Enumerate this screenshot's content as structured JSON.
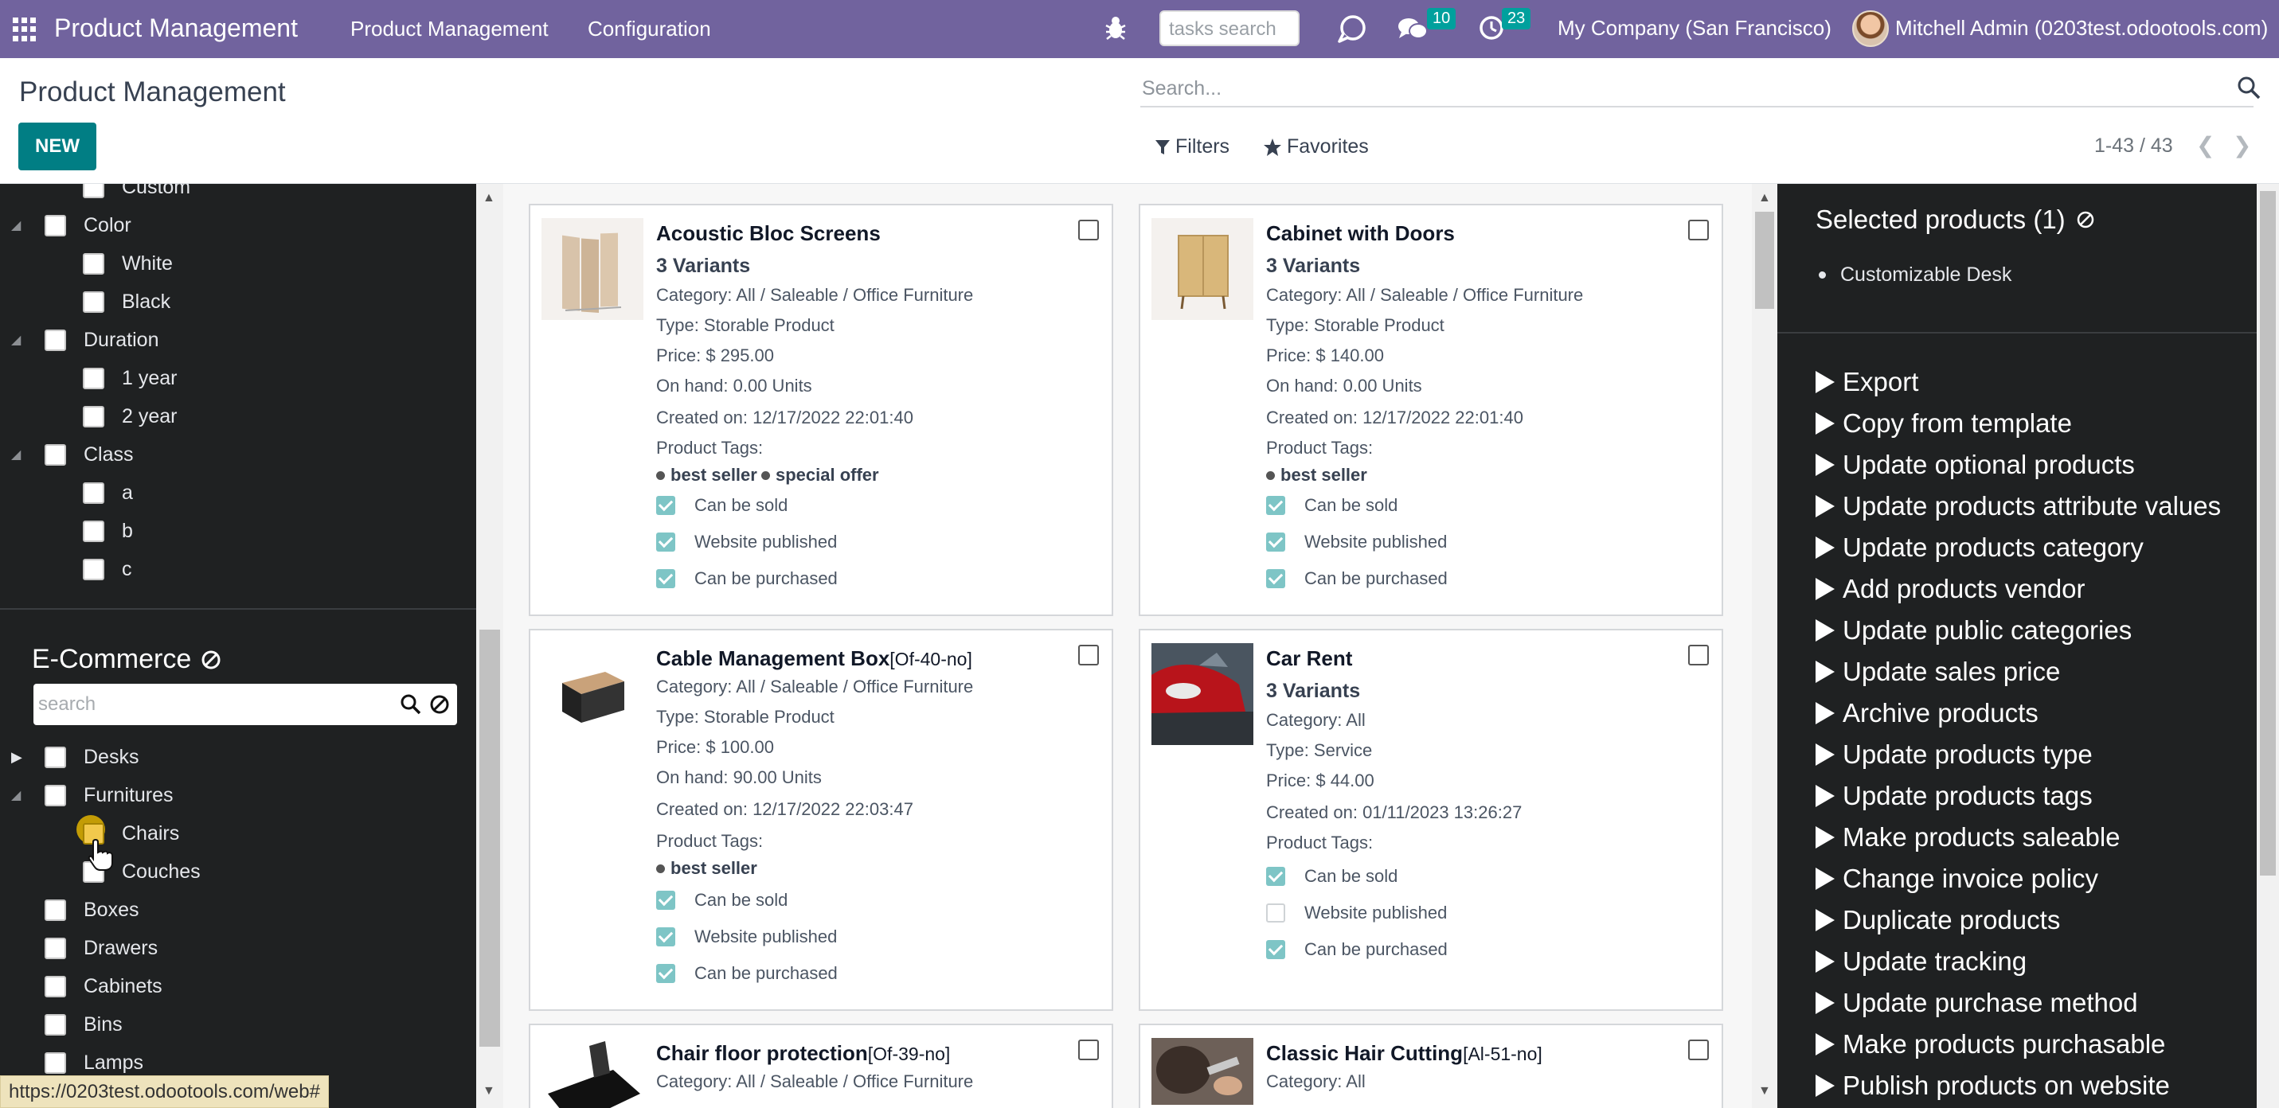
{
  "navbar": {
    "brand": "Product Management",
    "menus": [
      "Product Management",
      "Configuration"
    ],
    "tasks_search_placeholder": "tasks search",
    "messages_count": "10",
    "activities_count": "23",
    "company": "My Company (San Francisco)",
    "user": "Mitchell Admin (0203test.odootools.com)",
    "bg_color": "#71639e"
  },
  "control": {
    "title": "Product Management",
    "new_label": "NEW",
    "search_placeholder": "Search...",
    "filters_label": "Filters",
    "favorites_label": "Favorites",
    "pager": "1-43 / 43"
  },
  "attributes": {
    "items": [
      {
        "label": "Custom",
        "level": 1
      },
      {
        "label": "Color",
        "level": 0
      },
      {
        "label": "White",
        "level": 1
      },
      {
        "label": "Black",
        "level": 1
      },
      {
        "label": "Duration",
        "level": 0
      },
      {
        "label": "1 year",
        "level": 1
      },
      {
        "label": "2 year",
        "level": 1
      },
      {
        "label": "Class",
        "level": 0
      },
      {
        "label": "a",
        "level": 1
      },
      {
        "label": "b",
        "level": 1
      },
      {
        "label": "c",
        "level": 1
      }
    ]
  },
  "ecommerce": {
    "title": "E-Commerce",
    "search_placeholder": "search",
    "items": [
      {
        "label": "Desks",
        "level": 0
      },
      {
        "label": "Furnitures",
        "level": 0
      },
      {
        "label": "Chairs",
        "level": 1
      },
      {
        "label": "Couches",
        "level": 1
      },
      {
        "label": "Boxes",
        "level": 0
      },
      {
        "label": "Drawers",
        "level": 0
      },
      {
        "label": "Cabinets",
        "level": 0
      },
      {
        "label": "Bins",
        "level": 0
      },
      {
        "label": "Lamps",
        "level": 0
      }
    ]
  },
  "status_url": "https://0203test.odootools.com/web#",
  "products": [
    {
      "name": "Acoustic Bloc Screens",
      "ref": "",
      "variants": "3 Variants",
      "category": "Category: All / Saleable / Office Furniture",
      "type": "Type: Storable Product",
      "price": "Price: $ 295.00",
      "on_hand": "On hand: 0.00 Units",
      "created": "Created on: 12/17/2022 22:01:40",
      "tags_label": "Product Tags:",
      "tags": [
        "best seller",
        "special offer"
      ],
      "checks": [
        {
          "label": "Can be sold",
          "on": true
        },
        {
          "label": "Website published",
          "on": true
        },
        {
          "label": "Can be purchased",
          "on": true
        }
      ]
    },
    {
      "name": "Cabinet with Doors",
      "ref": "",
      "variants": "3 Variants",
      "category": "Category: All / Saleable / Office Furniture",
      "type": "Type: Storable Product",
      "price": "Price: $ 140.00",
      "on_hand": "On hand: 0.00 Units",
      "created": "Created on: 12/17/2022 22:01:40",
      "tags_label": "Product Tags:",
      "tags": [
        "best seller"
      ],
      "checks": [
        {
          "label": "Can be sold",
          "on": true
        },
        {
          "label": "Website published",
          "on": true
        },
        {
          "label": "Can be purchased",
          "on": true
        }
      ]
    },
    {
      "name": "Cable Management Box",
      "ref": "[Of-40-no]",
      "variants": "",
      "category": "Category: All / Saleable / Office Furniture",
      "type": "Type: Storable Product",
      "price": "Price: $ 100.00",
      "on_hand": "On hand: 90.00 Units",
      "created": "Created on: 12/17/2022 22:03:47",
      "tags_label": "Product Tags:",
      "tags": [
        "best seller"
      ],
      "checks": [
        {
          "label": "Can be sold",
          "on": true
        },
        {
          "label": "Website published",
          "on": true
        },
        {
          "label": "Can be purchased",
          "on": true
        }
      ]
    },
    {
      "name": "Car Rent",
      "ref": "",
      "variants": "3 Variants",
      "category": "Category: All",
      "type": "Type: Service",
      "price": "Price: $ 44.00",
      "on_hand": "",
      "created": "Created on: 01/11/2023 13:26:27",
      "tags_label": "Product Tags:",
      "tags": [],
      "checks": [
        {
          "label": "Can be sold",
          "on": true
        },
        {
          "label": "Website published",
          "on": false
        },
        {
          "label": "Can be purchased",
          "on": true
        }
      ]
    },
    {
      "name": "Chair floor protection",
      "ref": "[Of-39-no]",
      "variants": "",
      "category": "Category: All / Saleable / Office Furniture"
    },
    {
      "name": "Classic Hair Cutting",
      "ref": "[Al-51-no]",
      "variants": "",
      "category": "Category: All"
    }
  ],
  "selected": {
    "title": "Selected products (1)",
    "items": [
      "Customizable Desk"
    ]
  },
  "actions": [
    "Export",
    "Copy from template",
    "Update optional products",
    "Update products attribute values",
    "Update products category",
    "Add products vendor",
    "Update public categories",
    "Update sales price",
    "Archive products",
    "Update products type",
    "Update products tags",
    "Make products saleable",
    "Change invoice policy",
    "Duplicate products",
    "Update tracking",
    "Update purchase method",
    "Make products purchasable",
    "Publish products on website"
  ]
}
